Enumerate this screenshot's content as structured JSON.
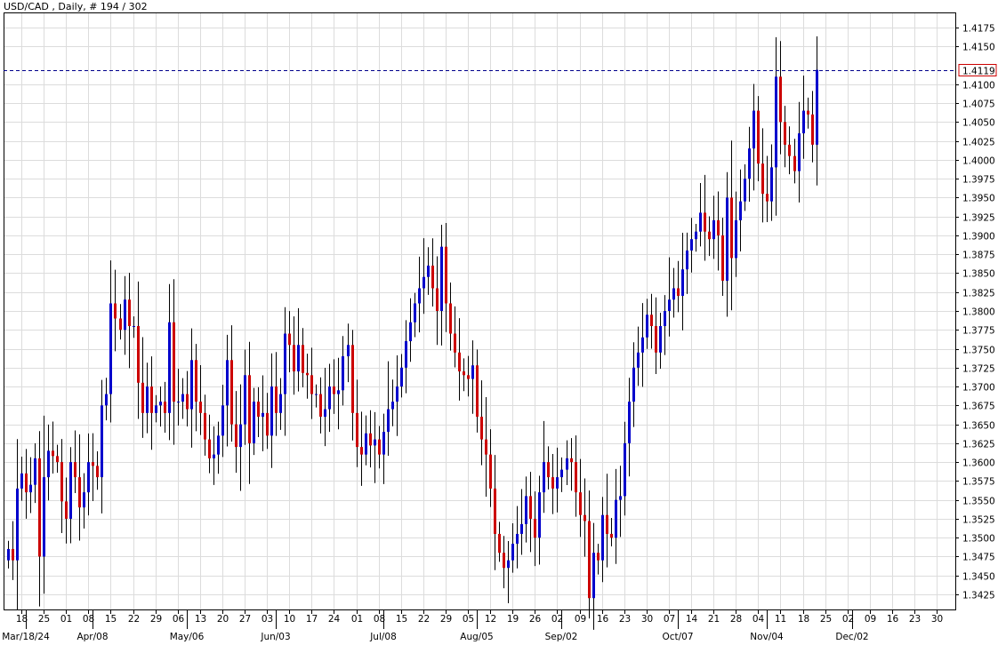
{
  "chart_data": {
    "type": "candlestick",
    "title": "USD/CAD , Daily, # 194 / 302",
    "symbol": "USD/CAD",
    "timeframe": "Daily",
    "bar_counter": "# 194 / 302",
    "current_price": 1.4119,
    "current_price_label": "1.4119",
    "grid": true,
    "ylim": [
      1.3405,
      1.4195
    ],
    "y_ticks": [
      "1.3425",
      "1.3450",
      "1.3475",
      "1.3500",
      "1.3525",
      "1.3550",
      "1.3575",
      "1.3600",
      "1.3625",
      "1.3650",
      "1.3675",
      "1.3700",
      "1.3725",
      "1.3750",
      "1.3775",
      "1.3800",
      "1.3825",
      "1.3850",
      "1.3875",
      "1.3900",
      "1.3925",
      "1.3950",
      "1.3975",
      "1.4000",
      "1.4025",
      "1.4050",
      "1.4075",
      "1.4100",
      "1.4150",
      "1.4175"
    ],
    "x_ticks": [
      {
        "bar": 3,
        "label": "18"
      },
      {
        "bar": 8,
        "label": "25"
      },
      {
        "bar": 13,
        "label": "01"
      },
      {
        "bar": 18,
        "label": "08"
      },
      {
        "bar": 23,
        "label": "15"
      },
      {
        "bar": 28,
        "label": "22"
      },
      {
        "bar": 33,
        "label": "29"
      },
      {
        "bar": 38,
        "label": "06"
      },
      {
        "bar": 43,
        "label": "13"
      },
      {
        "bar": 48,
        "label": "20"
      },
      {
        "bar": 53,
        "label": "27"
      },
      {
        "bar": 58,
        "label": "03"
      },
      {
        "bar": 63,
        "label": "10"
      },
      {
        "bar": 68,
        "label": "17"
      },
      {
        "bar": 73,
        "label": "24"
      },
      {
        "bar": 78,
        "label": "01"
      },
      {
        "bar": 83,
        "label": "08"
      },
      {
        "bar": 88,
        "label": "15"
      },
      {
        "bar": 93,
        "label": "22"
      },
      {
        "bar": 98,
        "label": "29"
      },
      {
        "bar": 103,
        "label": "05"
      },
      {
        "bar": 108,
        "label": "12"
      },
      {
        "bar": 113,
        "label": "19"
      },
      {
        "bar": 118,
        "label": "26"
      },
      {
        "bar": 123,
        "label": "02"
      },
      {
        "bar": 128,
        "label": "09"
      },
      {
        "bar": 133,
        "label": "16"
      },
      {
        "bar": 138,
        "label": "23"
      },
      {
        "bar": 143,
        "label": "30"
      },
      {
        "bar": 148,
        "label": "07"
      },
      {
        "bar": 153,
        "label": "14"
      },
      {
        "bar": 158,
        "label": "21"
      },
      {
        "bar": 163,
        "label": "28"
      },
      {
        "bar": 168,
        "label": "04"
      },
      {
        "bar": 173,
        "label": "11"
      },
      {
        "bar": 178,
        "label": "18"
      },
      {
        "bar": 183,
        "label": "25"
      },
      {
        "bar": 188,
        "label": "02"
      },
      {
        "bar": 193,
        "label": "09"
      },
      {
        "bar": 198,
        "label": "16"
      },
      {
        "bar": 203,
        "label": "23"
      },
      {
        "bar": 208,
        "label": "30"
      }
    ],
    "month_labels": [
      {
        "bar": 4,
        "label": "Mar/18/24"
      },
      {
        "bar": 19,
        "label": "Apr/08"
      },
      {
        "bar": 40,
        "label": "May/06"
      },
      {
        "bar": 60,
        "label": "Jun/03"
      },
      {
        "bar": 84,
        "label": "Jul/08"
      },
      {
        "bar": 105,
        "label": "Aug/05"
      },
      {
        "bar": 124,
        "label": "Sep/02"
      },
      {
        "bar": 150,
        "label": "Oct/07"
      },
      {
        "bar": 170,
        "label": "Nov/04"
      },
      {
        "bar": 189,
        "label": "Dec/02"
      }
    ],
    "bull_color": "#0000cc",
    "bear_color": "#cc0000",
    "price_line_color": "#00008b",
    "price_label_border": "#cc0000",
    "grid_color": "#dcdcdc",
    "closes": [
      1.3485,
      1.347,
      1.3565,
      1.3585,
      1.356,
      1.357,
      1.3605,
      1.3475,
      1.358,
      1.3615,
      1.3608,
      1.36,
      1.3548,
      1.3525,
      1.36,
      1.358,
      1.354,
      1.356,
      1.36,
      1.3595,
      1.358,
      1.3675,
      1.369,
      1.381,
      1.379,
      1.3775,
      1.3815,
      1.378,
      1.378,
      1.3705,
      1.3665,
      1.37,
      1.3665,
      1.3675,
      1.368,
      1.3665,
      1.3785,
      1.368,
      1.368,
      1.369,
      1.367,
      1.3735,
      1.368,
      1.3665,
      1.363,
      1.3605,
      1.361,
      1.3635,
      1.3675,
      1.3735,
      1.365,
      1.362,
      1.365,
      1.3715,
      1.3625,
      1.368,
      1.366,
      1.3665,
      1.3635,
      1.37,
      1.3665,
      1.369,
      1.377,
      1.3755,
      1.372,
      1.3755,
      1.3718,
      1.3715,
      1.369,
      1.369,
      1.366,
      1.367,
      1.37,
      1.369,
      1.3695,
      1.374,
      1.3755,
      1.3665,
      1.362,
      1.361,
      1.3638,
      1.3622,
      1.363,
      1.361,
      1.364,
      1.367,
      1.368,
      1.37,
      1.3725,
      1.376,
      1.3785,
      1.381,
      1.383,
      1.3845,
      1.386,
      1.383,
      1.38,
      1.3885,
      1.381,
      1.377,
      1.3745,
      1.372,
      1.3715,
      1.371,
      1.3728,
      1.366,
      1.363,
      1.361,
      1.3565,
      1.3505,
      1.348,
      1.346,
      1.347,
      1.3492,
      1.3505,
      1.3518,
      1.3555,
      1.3525,
      1.35,
      1.356,
      1.36,
      1.358,
      1.3565,
      1.358,
      1.359,
      1.3605,
      1.36,
      1.356,
      1.353,
      1.3522,
      1.342,
      1.348,
      1.347,
      1.353,
      1.3505,
      1.35,
      1.355,
      1.3555,
      1.3625,
      1.368,
      1.3725,
      1.3745,
      1.3765,
      1.3795,
      1.378,
      1.3745,
      1.378,
      1.38,
      1.3815,
      1.383,
      1.382,
      1.3855,
      1.388,
      1.3895,
      1.3905,
      1.393,
      1.3905,
      1.3895,
      1.392,
      1.39,
      1.384,
      1.395,
      1.387,
      1.392,
      1.3945,
      1.3975,
      1.4015,
      1.4065,
      1.3995,
      1.3955,
      1.3945,
      1.399,
      1.411,
      1.405,
      1.402,
      1.4005,
      1.3985,
      1.4035,
      1.4065,
      1.406,
      1.402,
      1.4119
    ],
    "opens": [
      1.347,
      1.3485,
      1.347,
      1.3565,
      1.3585,
      1.356,
      1.357,
      1.3605,
      1.3475,
      1.358,
      1.3615,
      1.3608,
      1.36,
      1.3548,
      1.3525,
      1.36,
      1.358,
      1.354,
      1.356,
      1.36,
      1.3595,
      1.358,
      1.3675,
      1.369,
      1.381,
      1.379,
      1.3775,
      1.3815,
      1.378,
      1.378,
      1.3705,
      1.3665,
      1.37,
      1.3665,
      1.3675,
      1.368,
      1.3665,
      1.3785,
      1.368,
      1.368,
      1.369,
      1.367,
      1.3735,
      1.368,
      1.3665,
      1.363,
      1.3605,
      1.361,
      1.3635,
      1.3675,
      1.3735,
      1.365,
      1.362,
      1.365,
      1.3715,
      1.3625,
      1.368,
      1.366,
      1.3665,
      1.3635,
      1.37,
      1.3665,
      1.369,
      1.377,
      1.3755,
      1.372,
      1.3755,
      1.3718,
      1.3715,
      1.369,
      1.369,
      1.366,
      1.367,
      1.37,
      1.369,
      1.3695,
      1.374,
      1.3755,
      1.3665,
      1.362,
      1.361,
      1.3638,
      1.3622,
      1.363,
      1.361,
      1.364,
      1.367,
      1.368,
      1.37,
      1.3725,
      1.376,
      1.3785,
      1.381,
      1.383,
      1.3845,
      1.386,
      1.383,
      1.38,
      1.3885,
      1.381,
      1.377,
      1.3745,
      1.372,
      1.3715,
      1.371,
      1.3728,
      1.366,
      1.363,
      1.361,
      1.3565,
      1.3505,
      1.348,
      1.346,
      1.347,
      1.3492,
      1.3505,
      1.3518,
      1.3555,
      1.3525,
      1.35,
      1.356,
      1.36,
      1.358,
      1.3565,
      1.358,
      1.359,
      1.3605,
      1.36,
      1.356,
      1.353,
      1.3522,
      1.342,
      1.348,
      1.347,
      1.353,
      1.3505,
      1.35,
      1.355,
      1.3555,
      1.3625,
      1.368,
      1.3725,
      1.3745,
      1.3765,
      1.3795,
      1.378,
      1.3745,
      1.378,
      1.38,
      1.3815,
      1.383,
      1.382,
      1.3855,
      1.388,
      1.3895,
      1.3905,
      1.393,
      1.3905,
      1.3895,
      1.392,
      1.39,
      1.384,
      1.395,
      1.387,
      1.392,
      1.3945,
      1.3975,
      1.4015,
      1.4065,
      1.3995,
      1.3955,
      1.3945,
      1.399,
      1.411,
      1.405,
      1.402,
      1.4005,
      1.3985,
      1.4035,
      1.4065,
      1.406,
      1.402
    ]
  }
}
